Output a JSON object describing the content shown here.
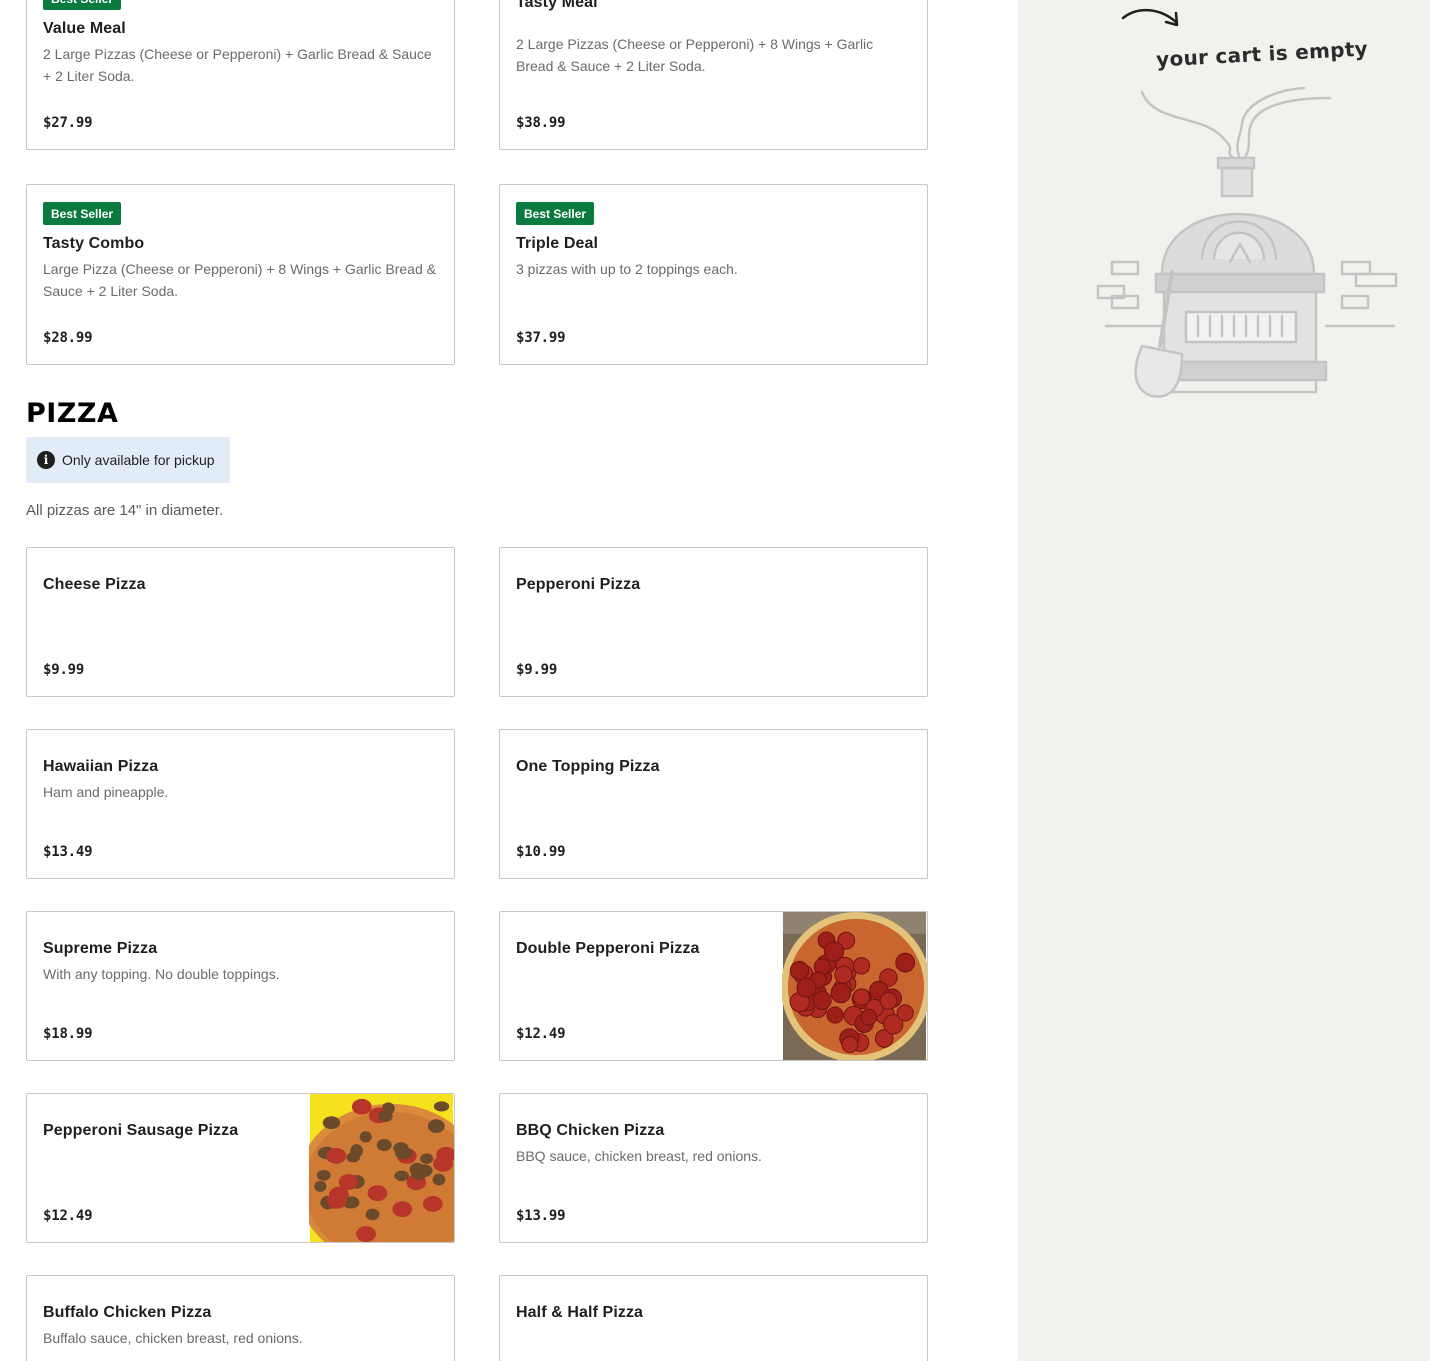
{
  "deals": [
    {
      "badge": "Best Seller",
      "name": "Value Meal",
      "desc": "2 Large Pizzas (Cheese or Pepperoni) + Garlic Bread & Sauce + 2 Liter Soda.",
      "price": "$27.99"
    },
    {
      "badge": "",
      "name": "Tasty Meal",
      "desc": "2 Large Pizzas (Cheese or Pepperoni) + 8 Wings + Garlic Bread & Sauce + 2 Liter Soda.",
      "price": "$38.99"
    },
    {
      "badge": "Best Seller",
      "name": "Tasty Combo",
      "desc": "Large Pizza (Cheese or Pepperoni) + 8 Wings + Garlic Bread & Sauce + 2 Liter Soda.",
      "price": "$28.99"
    },
    {
      "badge": "Best Seller",
      "name": "Triple Deal",
      "desc": "3 pizzas with up to 2 toppings each.",
      "price": "$37.99"
    }
  ],
  "pizza_section": {
    "title": "PIZZA",
    "pickup_note": "Only available for pickup",
    "info_glyph": "i",
    "description": "All pizzas are 14\" in diameter.",
    "items": [
      {
        "name": "Cheese Pizza",
        "desc": "",
        "price": "$9.99"
      },
      {
        "name": "Pepperoni Pizza",
        "desc": "",
        "price": "$9.99"
      },
      {
        "name": "Hawaiian Pizza",
        "desc": "Ham and pineapple.",
        "price": "$13.49"
      },
      {
        "name": "One Topping Pizza",
        "desc": "",
        "price": "$10.99"
      },
      {
        "name": "Supreme Pizza",
        "desc": "With any topping. No double toppings.",
        "price": "$18.99"
      },
      {
        "name": "Double Pepperoni Pizza",
        "desc": "",
        "price": "$12.49"
      },
      {
        "name": "Pepperoni Sausage Pizza",
        "desc": "",
        "price": "$12.49"
      },
      {
        "name": "BBQ Chicken Pizza",
        "desc": "BBQ sauce, chicken breast, red onions.",
        "price": "$13.99"
      },
      {
        "name": "Buffalo Chicken Pizza",
        "desc": "Buffalo sauce, chicken breast, red onions.",
        "price": ""
      },
      {
        "name": "Half & Half Pizza",
        "desc": "",
        "price": ""
      }
    ]
  },
  "cart": {
    "empty_text": "your cart is empty"
  },
  "colors": {
    "badge_green": "#0b7a3e",
    "pickup_bg": "#e2ecf8",
    "cart_bg": "#f2f1ee"
  }
}
